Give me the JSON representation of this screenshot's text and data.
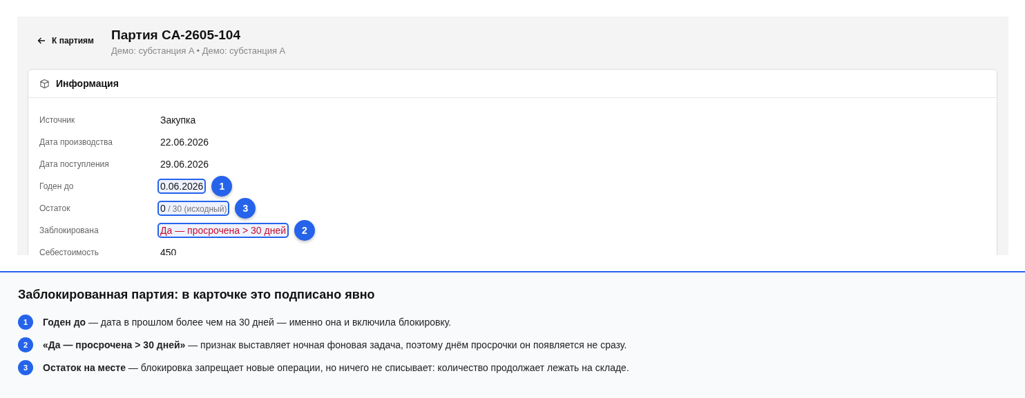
{
  "header": {
    "back": "К партиям",
    "title": "Партия CA-2605-104",
    "subtitle": "Демо: субстанция A • Демо: субстанция A"
  },
  "card": {
    "title": "Информация",
    "rows": [
      {
        "label": "Источник",
        "value": "Закупка",
        "alert": false
      },
      {
        "label": "Дата производства",
        "value": "22.06.2026",
        "alert": false
      },
      {
        "label": "Дата поступления",
        "value": "29.06.2026",
        "alert": false
      },
      {
        "label": "Годен до",
        "value": "0.06.2026",
        "alert": false,
        "callout": "1"
      },
      {
        "label": "Остаток",
        "value": "0",
        "note": "/ 30 (исходный)",
        "alert": false,
        "callout": "3"
      },
      {
        "label": "Заблокирована",
        "value": "Да — просрочена > 30 дней",
        "alert": true,
        "callout": "2"
      },
      {
        "label": "Себестоимость",
        "value": "450",
        "alert": false
      }
    ]
  },
  "explanation": {
    "title": "Заблокированная партия: в карточке это подписано явно",
    "items": [
      {
        "number": "1",
        "text": "**Годен до** — дата в прошлом более чем на 30 дней — именно она и включила блокировку."
      },
      {
        "number": "2",
        "text": "**«Да — просрочена > 30 дней»** — признак выставляет ночная фоновая задача, поэтому днём просрочки он появляется не сразу."
      },
      {
        "number": "3",
        "text": "**Остаток на месте** — блокировка запрещает новые операции, но ничего не списывает: количество продолжает лежать на складе."
      }
    ]
  }
}
